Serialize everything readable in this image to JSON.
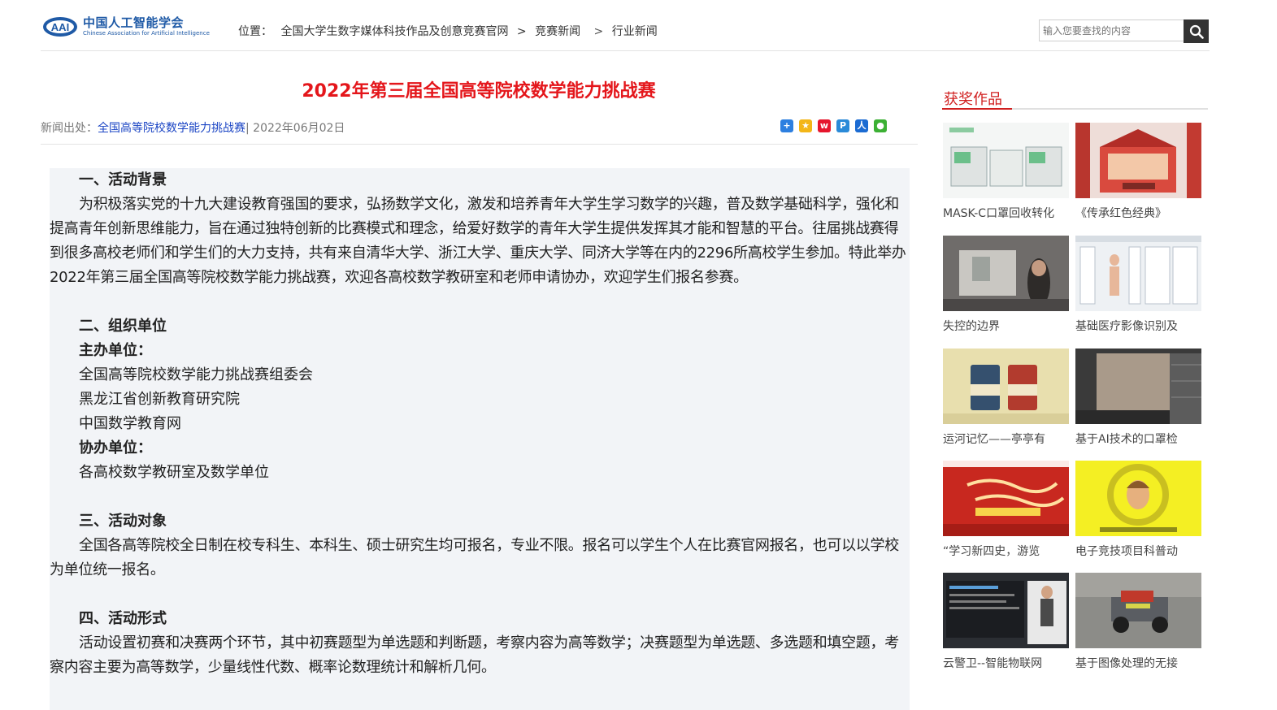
{
  "header": {
    "logo_cn": "中国人工智能学会",
    "logo_en": "Chinese Association for Artificial Intelligence",
    "breadcrumb": [
      "位置：",
      "全国大学生数字媒体科技作品及创意竞赛官网",
      ">",
      "竞赛新闻",
      ">",
      "行业新闻"
    ],
    "search_placeholder": "输入您要查找的内容"
  },
  "article": {
    "title": "2022年第三届全国高等院校数学能力挑战赛",
    "source_label": "新闻出处：",
    "source_link": "全国高等院校数学能力挑战赛",
    "date": "| 2022年06月02日",
    "share_icons": [
      "share-plus-icon",
      "qzone-icon",
      "weibo-icon",
      "pinterest-icon",
      "renren-icon",
      "wechat-icon"
    ],
    "sections": {
      "s1_title": "一、活动背景",
      "s1_body": "为积极落实党的十九大建设教育强国的要求，弘扬数学文化，激发和培养青年大学生学习数学的兴趣，普及数学基础科学，强化和提高青年创新思维能力，旨在通过独特创新的比赛模式和理念，给爱好数学的青年大学生提供发挥其才能和智慧的平台。往届挑战赛得到很多高校老师们和学生们的大力支持，共有来自清华大学、浙江大学、重庆大学、同济大学等在内的2296所高校学生参加。特此举办2022年第三届全国高等院校数学能力挑战赛，欢迎各高校数学教研室和老师申请协办，欢迎学生们报名参赛。",
      "s2_title": "二、组织单位",
      "s2_host_label": "主办单位：",
      "s2_hosts": [
        "全国高等院校数学能力挑战赛组委会",
        "黑龙江省创新教育研究院",
        "中国数学教育网"
      ],
      "s2_co_label": "协办单位：",
      "s2_co": "各高校数学教研室及数学单位",
      "s3_title": "三、活动对象",
      "s3_body": "全国各高等院校全日制在校专科生、本科生、硕士研究生均可报名，专业不限。报名可以学生个人在比赛官网报名，也可以以学校为单位统一报名。",
      "s4_title": "四、活动形式",
      "s4_body": "活动设置初赛和决赛两个环节，其中初赛题型为单选题和判断题，考察内容为高等数学；决赛题型为单选题、多选题和填空题，考察内容主要为高等数学，少量线性代数、概率论数理统计和解析几何。"
    }
  },
  "sidebar": {
    "title": "获奖作品",
    "items": [
      {
        "caption": "MASK-C口罩回收转化"
      },
      {
        "caption": "《传承红色经典》"
      },
      {
        "caption": "失控的边界"
      },
      {
        "caption": "基础医疗影像识别及"
      },
      {
        "caption": "运河记忆——亭亭有"
      },
      {
        "caption": "基于AI技术的口罩检"
      },
      {
        "caption": "“学习新四史，游览"
      },
      {
        "caption": "电子竞技项目科普动"
      },
      {
        "caption": "云警卫--智能物联网"
      },
      {
        "caption": "基于图像处理的无接"
      }
    ]
  },
  "colors": {
    "title_red": "#e4161b",
    "link_blue": "#1a44c4",
    "brand_blue": "#1f5aa6",
    "content_bg": "#f2f4f7"
  }
}
